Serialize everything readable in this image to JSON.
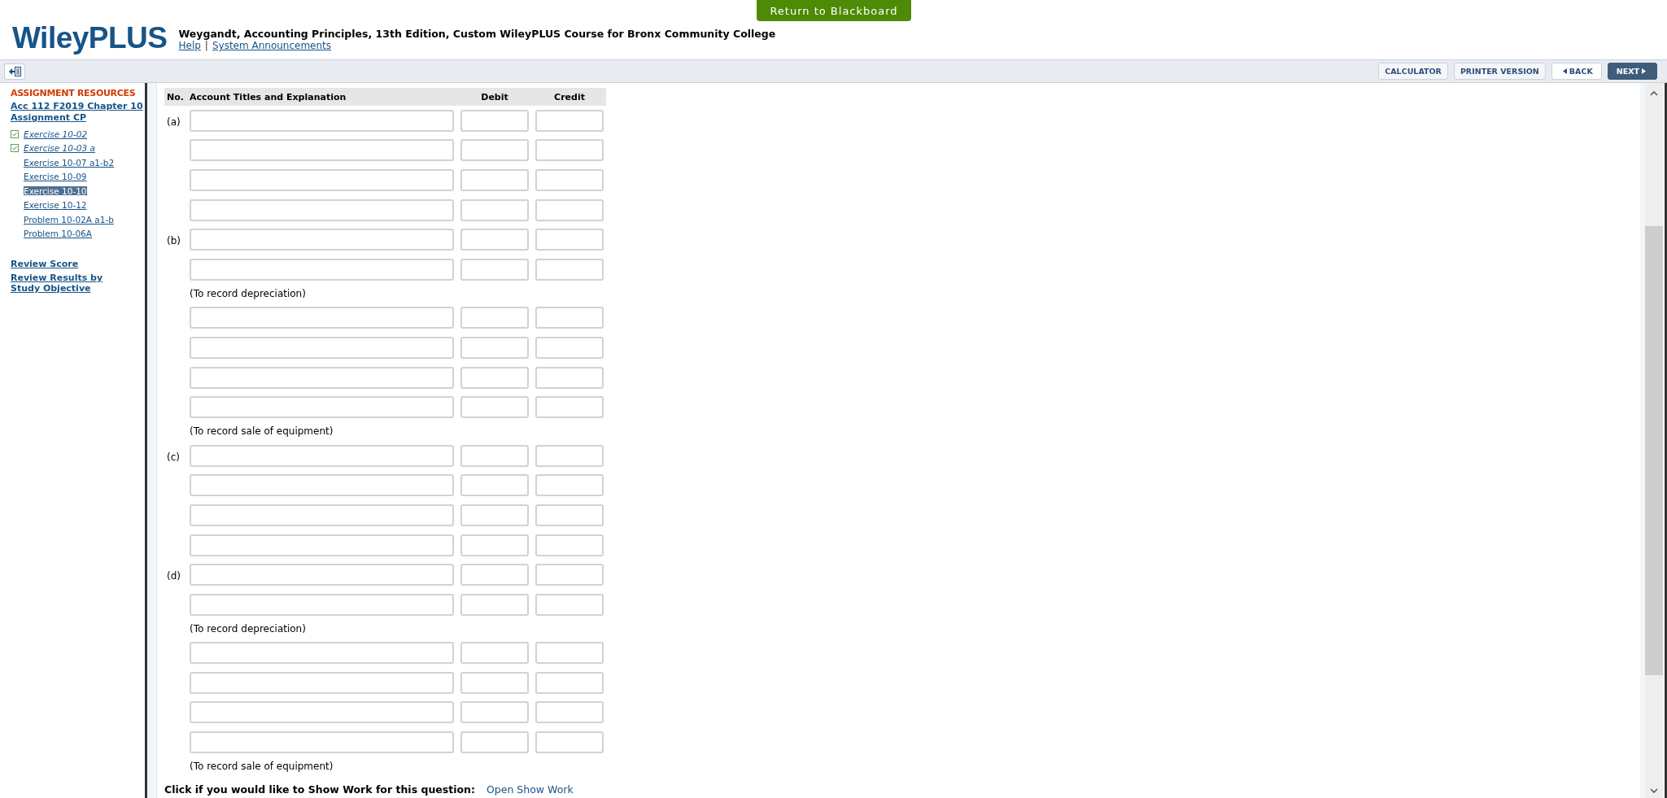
{
  "header": {
    "logo": "WileyPLUS",
    "course_title": "Weygandt, Accounting Principles, 13th Edition, Custom WileyPLUS Course for Bronx Community College",
    "links": [
      "Help",
      "System Announcements"
    ],
    "separator": "|",
    "return_button": "Return to Blackboard"
  },
  "toolbar": {
    "buttons": [
      {
        "label": "CALCULATOR",
        "kind": "plain"
      },
      {
        "label": "PRINTER VERSION",
        "kind": "plain"
      },
      {
        "label": "BACK",
        "kind": "back"
      },
      {
        "label": "NEXT",
        "kind": "next"
      }
    ]
  },
  "sidebar": {
    "heading": "ASSIGNMENT RESOURCES",
    "assignment": "Acc 112 F2019 Chapter 10 Assignment CP",
    "items": [
      {
        "label": "Exercise 10-02",
        "checked": true,
        "selected": false
      },
      {
        "label": "Exercise 10-03 a",
        "checked": true,
        "selected": false
      },
      {
        "label": "Exercise 10-07 a1-b2",
        "checked": false,
        "selected": false
      },
      {
        "label": "Exercise 10-09",
        "checked": false,
        "selected": false
      },
      {
        "label": "Exercise 10-10",
        "checked": false,
        "selected": true
      },
      {
        "label": "Exercise 10-12",
        "checked": false,
        "selected": false
      },
      {
        "label": "Problem 10-02A a1-b",
        "checked": false,
        "selected": false
      },
      {
        "label": "Problem 10-06A",
        "checked": false,
        "selected": false
      }
    ],
    "links": [
      "Review Score",
      "Review Results by Study Objective"
    ]
  },
  "journal": {
    "columns": [
      "No.",
      "Account Titles and Explanation",
      "Debit",
      "Credit"
    ],
    "blocks": [
      {
        "label": "(a)",
        "lines": [
          {
            "kind": "entry"
          },
          {
            "kind": "entry"
          },
          {
            "kind": "entry"
          },
          {
            "kind": "entry"
          }
        ]
      },
      {
        "label": "(b)",
        "lines": [
          {
            "kind": "entry"
          },
          {
            "kind": "entry"
          }
        ],
        "note": "(To record depreciation)"
      },
      {
        "lines": [
          {
            "kind": "entry"
          },
          {
            "kind": "entry"
          },
          {
            "kind": "entry"
          },
          {
            "kind": "entry"
          }
        ],
        "note": "(To record sale of equipment)"
      },
      {
        "label": "(c)",
        "lines": [
          {
            "kind": "entry"
          },
          {
            "kind": "entry"
          },
          {
            "kind": "entry"
          },
          {
            "kind": "entry"
          }
        ]
      },
      {
        "label": "(d)",
        "lines": [
          {
            "kind": "entry"
          },
          {
            "kind": "entry"
          }
        ],
        "note": "(To record depreciation)"
      },
      {
        "lines": [
          {
            "kind": "entry"
          },
          {
            "kind": "entry"
          },
          {
            "kind": "entry"
          },
          {
            "kind": "entry"
          }
        ],
        "note": "(To record sale of equipment)"
      }
    ]
  },
  "show_work": {
    "prompt": "Click if you would like to Show Work for this question:",
    "link": "Open Show Work"
  }
}
